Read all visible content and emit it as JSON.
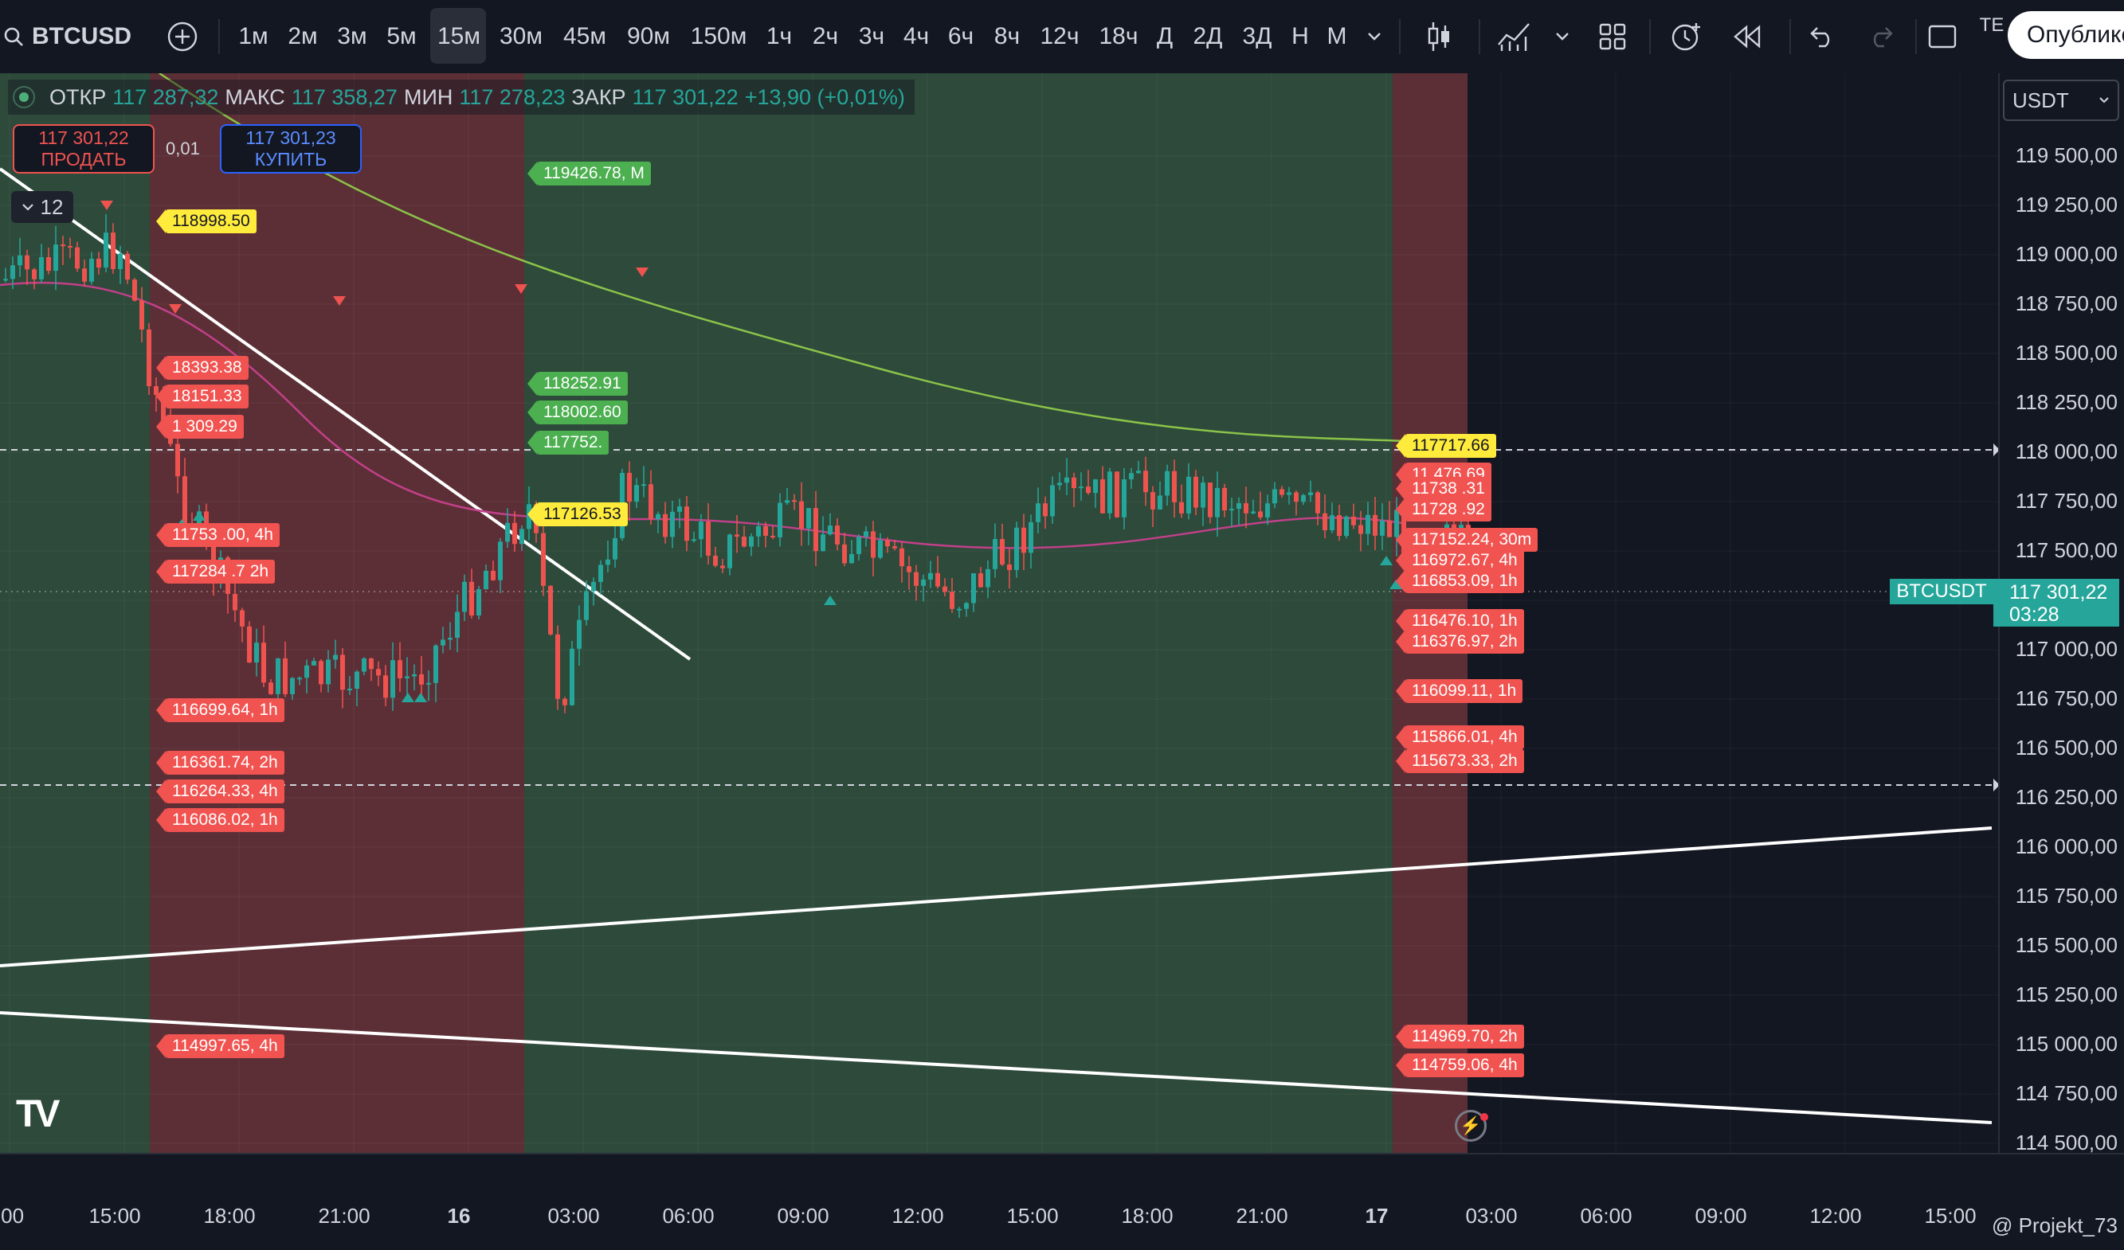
{
  "toolbar": {
    "symbol": "BTCUSD",
    "intervals": [
      "1м",
      "2м",
      "3м",
      "5м",
      "15м",
      "30м",
      "45м",
      "90м",
      "150м",
      "1ч",
      "2ч",
      "3ч",
      "4ч",
      "6ч",
      "8ч",
      "12ч",
      "18ч",
      "Д",
      "2Д",
      "3Д",
      "Н",
      "М"
    ],
    "active_interval": "15м",
    "tb_cut": "TЕ",
    "publish_label": "Опублико"
  },
  "legend": {
    "open_key": "ОТКР",
    "open": "117 287,32",
    "high_key": "МАКС",
    "high": "117 358,27",
    "low_key": "МИН",
    "low": "117 278,23",
    "close_key": "ЗАКР",
    "close": "117 301,22",
    "change": "+13,90 (+0,01%)"
  },
  "trade": {
    "sell_price": "117 301,22",
    "sell_label": "ПРОДАТЬ",
    "spread": "0,01",
    "buy_price": "117 301,23",
    "buy_label": "КУПИТЬ"
  },
  "indicators_collapse": {
    "count": "12"
  },
  "price_labels": [
    {
      "text": "118998.50",
      "color": "yellow"
    },
    {
      "text": "18393.38",
      "color": "red"
    },
    {
      "text": "18151.33",
      "color": "red"
    },
    {
      "text": "1 309.29",
      "color": "red"
    },
    {
      "text": "11753 .00, 4h",
      "color": "red"
    },
    {
      "text": "117284 .7 2h",
      "color": "red"
    },
    {
      "text": "116699.64, 1h",
      "color": "red"
    },
    {
      "text": "116361.74, 2h",
      "color": "red"
    },
    {
      "text": "116264.33, 4h",
      "color": "red"
    },
    {
      "text": "116086.02, 1h",
      "color": "red"
    },
    {
      "text": "114997.65, 4h",
      "color": "red"
    },
    {
      "text": "119426.78, M",
      "color": "green"
    },
    {
      "text": "118252.91",
      "color": "green"
    },
    {
      "text": "118002.60",
      "color": "green"
    },
    {
      "text": "117752.",
      "color": "green"
    },
    {
      "text": "117126.53",
      "color": "yellow"
    },
    {
      "text": "117717.66",
      "color": "yellow"
    },
    {
      "text": "11 476.69",
      "color": "red"
    },
    {
      "text": "11738 .31",
      "color": "red"
    },
    {
      "text": "11728 .92",
      "color": "red"
    },
    {
      "text": "117152.24, 30m",
      "color": "red"
    },
    {
      "text": "116972.67, 4h",
      "color": "red"
    },
    {
      "text": "116853.09, 1h",
      "color": "red"
    },
    {
      "text": "116476.10, 1h",
      "color": "red"
    },
    {
      "text": "116376.97, 2h",
      "color": "red"
    },
    {
      "text": "116099.11, 1h",
      "color": "red"
    },
    {
      "text": "115866.01, 4h",
      "color": "red"
    },
    {
      "text": "115673.33, 2h",
      "color": "red"
    },
    {
      "text": "114969.70, 2h",
      "color": "red"
    },
    {
      "text": "114759.06, 4h",
      "color": "red"
    }
  ],
  "yaxis": {
    "currency": "USDT",
    "ticks": [
      "119 500,00",
      "119 250,00",
      "119 000,00",
      "118 750,00",
      "118 500,00",
      "118 250,00",
      "118 000,00",
      "117 750,00",
      "117 500,00",
      "117 250,00",
      "117 000,00",
      "116 750,00",
      "116 500,00",
      "116 250,00",
      "116 000,00",
      "115 750,00",
      "115 500,00",
      "115 250,00",
      "115 000,00",
      "114 750,00",
      "114 500,00"
    ],
    "symbol_tag": "BTCUSDT",
    "last_price": "117 301,22",
    "countdown": "03:28"
  },
  "xaxis": {
    "ticks": [
      ":00",
      "15:00",
      "18:00",
      "21:00",
      "16",
      "03:00",
      "06:00",
      "09:00",
      "12:00",
      "15:00",
      "18:00",
      "21:00",
      "17",
      "03:00",
      "06:00",
      "09:00",
      "12:00",
      "15:00"
    ],
    "bold_ticks": [
      "16",
      "17"
    ]
  },
  "watermark": "@ Projekt_73",
  "tv_logo": "TV",
  "colors": {
    "bg": "#131722",
    "green_zone": "#2d4a3a",
    "red_zone": "#5c2f36",
    "up": "#26a69a",
    "down": "#ef5350",
    "sma_long": "#8bc34a",
    "sma_short": "#c2408a"
  },
  "icons": [
    "search-icon",
    "add-symbol-icon",
    "chevron-down-icon",
    "candles-icon",
    "indicators-icon",
    "layout-icon",
    "alert-icon",
    "replay-icon",
    "undo-icon",
    "redo-icon",
    "fullscreen-icon",
    "lightning-icon"
  ]
}
